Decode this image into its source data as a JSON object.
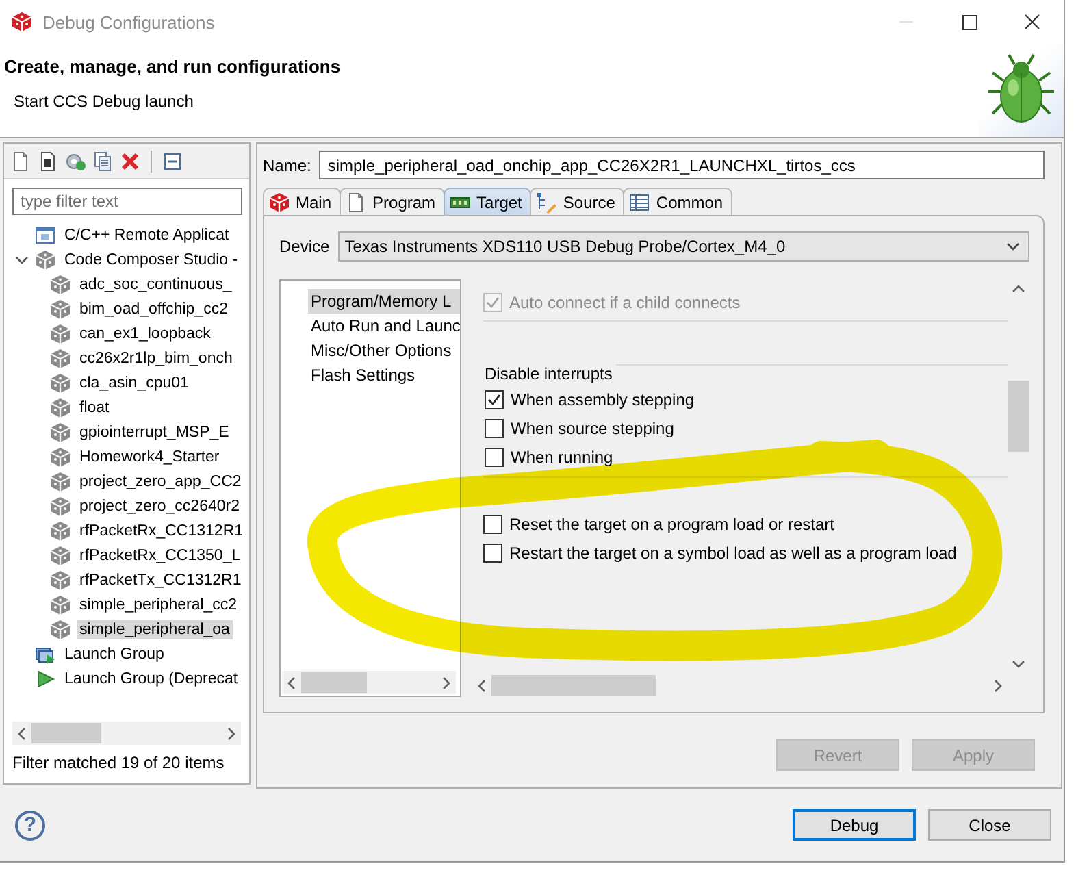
{
  "window": {
    "title": "Debug Configurations"
  },
  "header": {
    "title": "Create, manage, and run configurations",
    "subtitle": "Start CCS Debug launch"
  },
  "filter": {
    "placeholder": "type filter text"
  },
  "tree": [
    {
      "label": "C/C++ Remote Applicat",
      "kind": "remote-app",
      "selected": false
    },
    {
      "label": "Code Composer Studio -",
      "kind": "ccs",
      "expanded": true,
      "selected": false,
      "children": [
        {
          "label": "adc_soc_continuous_",
          "kind": "config",
          "selected": false
        },
        {
          "label": "bim_oad_offchip_cc2",
          "kind": "config",
          "selected": false
        },
        {
          "label": "can_ex1_loopback",
          "kind": "config",
          "selected": false
        },
        {
          "label": "cc26x2r1lp_bim_onch",
          "kind": "config",
          "selected": false
        },
        {
          "label": "cla_asin_cpu01",
          "kind": "config",
          "selected": false
        },
        {
          "label": "float",
          "kind": "config",
          "selected": false
        },
        {
          "label": "gpiointerrupt_MSP_E",
          "kind": "config",
          "selected": false
        },
        {
          "label": "Homework4_Starter",
          "kind": "config",
          "selected": false
        },
        {
          "label": "project_zero_app_CC2",
          "kind": "config",
          "selected": false
        },
        {
          "label": "project_zero_cc2640r2",
          "kind": "config",
          "selected": false
        },
        {
          "label": "rfPacketRx_CC1312R1",
          "kind": "config",
          "selected": false
        },
        {
          "label": "rfPacketRx_CC1350_L",
          "kind": "config",
          "selected": false
        },
        {
          "label": "rfPacketTx_CC1312R1",
          "kind": "config",
          "selected": false
        },
        {
          "label": "simple_peripheral_cc2",
          "kind": "config",
          "selected": false
        },
        {
          "label": "simple_peripheral_oa",
          "kind": "config",
          "selected": true
        }
      ]
    },
    {
      "label": "Launch Group",
      "kind": "launch-group",
      "selected": false
    },
    {
      "label": "Launch Group (Deprecat",
      "kind": "launch-group-deprecated",
      "selected": false
    }
  ],
  "filter_status": "Filter matched 19 of 20 items",
  "name_field": {
    "label": "Name:",
    "value": "simple_peripheral_oad_onchip_app_CC26X2R1_LAUNCHXL_tirtos_ccs"
  },
  "tabs": [
    {
      "label": "Main",
      "kind": "main",
      "selected": false
    },
    {
      "label": "Program",
      "kind": "program",
      "selected": false
    },
    {
      "label": "Target",
      "kind": "target",
      "selected": true
    },
    {
      "label": "Source",
      "kind": "source",
      "selected": false
    },
    {
      "label": "Common",
      "kind": "common",
      "selected": false
    }
  ],
  "device": {
    "label": "Device",
    "value": "Texas Instruments XDS110 USB Debug Probe/Cortex_M4_0"
  },
  "categories": [
    {
      "label": "Program/Memory L",
      "selected": true
    },
    {
      "label": "Auto Run and Launc",
      "selected": false
    },
    {
      "label": "Misc/Other Options",
      "selected": false
    },
    {
      "label": "Flash Settings",
      "selected": false
    }
  ],
  "connect_options": [
    {
      "label": "Auto connect if a child connects",
      "checked": true,
      "disabled": true
    }
  ],
  "disable_interrupts": {
    "title": "Disable interrupts",
    "options": [
      {
        "label": "When assembly stepping",
        "checked": true,
        "disabled": false
      },
      {
        "label": "When source stepping",
        "checked": false,
        "disabled": false
      },
      {
        "label": "When running",
        "checked": false,
        "disabled": false
      }
    ]
  },
  "reset_options": [
    {
      "label": "Reset the target on a program load or restart",
      "checked": false,
      "disabled": false
    },
    {
      "label": "Restart the target on a symbol load as well as a program load",
      "checked": false,
      "disabled": false
    }
  ],
  "edit_buttons": [
    {
      "label": "Revert",
      "disabled": true
    },
    {
      "label": "Apply",
      "disabled": true
    }
  ],
  "help_button": "?",
  "dialog_buttons": [
    {
      "label": "Debug",
      "default": true
    },
    {
      "label": "Close",
      "default": false
    }
  ]
}
